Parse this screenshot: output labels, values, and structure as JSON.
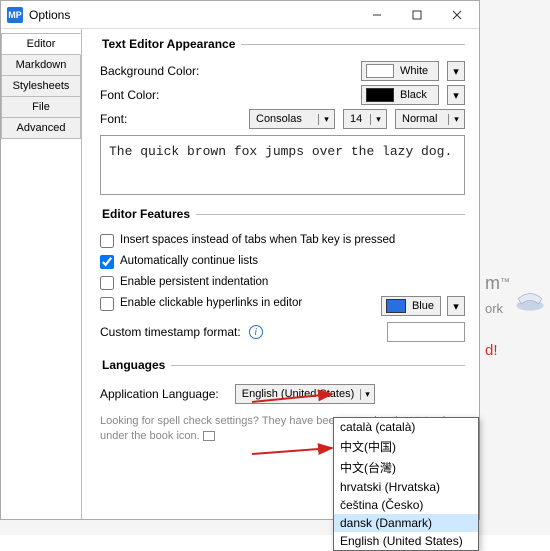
{
  "window": {
    "icon_text": "MP",
    "title": "Options"
  },
  "tabs": [
    "Editor",
    "Markdown",
    "Stylesheets",
    "File",
    "Advanced"
  ],
  "appearance": {
    "legend": "Text Editor Appearance",
    "bg_label": "Background Color:",
    "bg_value": "White",
    "bg_swatch": "#ffffff",
    "font_color_label": "Font Color:",
    "font_color_value": "Black",
    "font_color_swatch": "#000000",
    "font_label": "Font:",
    "font_value": "Consolas",
    "font_size": "14",
    "font_weight": "Normal",
    "preview": "The quick brown fox jumps over the lazy dog."
  },
  "features": {
    "legend": "Editor Features",
    "insert_spaces": "Insert spaces instead of tabs when Tab key is pressed",
    "auto_continue": "Automatically continue lists",
    "persistent_indent": "Enable persistent indentation",
    "clickable_links": "Enable clickable hyperlinks in editor",
    "link_color_value": "Blue",
    "link_color_swatch": "#2a6fe0",
    "timestamp_label": "Custom timestamp format:",
    "timestamp_value": ""
  },
  "languages": {
    "legend": "Languages",
    "label": "Application Language:",
    "value": "English (United States)",
    "options": [
      "català (català)",
      "中文(中国)",
      "中文(台灣)",
      "hrvatski (Hrvatska)",
      "čeština (Česko)",
      "dansk (Danmark)",
      "English (United States)"
    ],
    "selected_index": 5,
    "hint": "Looking for spell check settings? They have been moved to the status bar under the book icon."
  },
  "background": {
    "line1": "m",
    "tm": "™",
    "line2": "ork",
    "line3": "d!"
  }
}
